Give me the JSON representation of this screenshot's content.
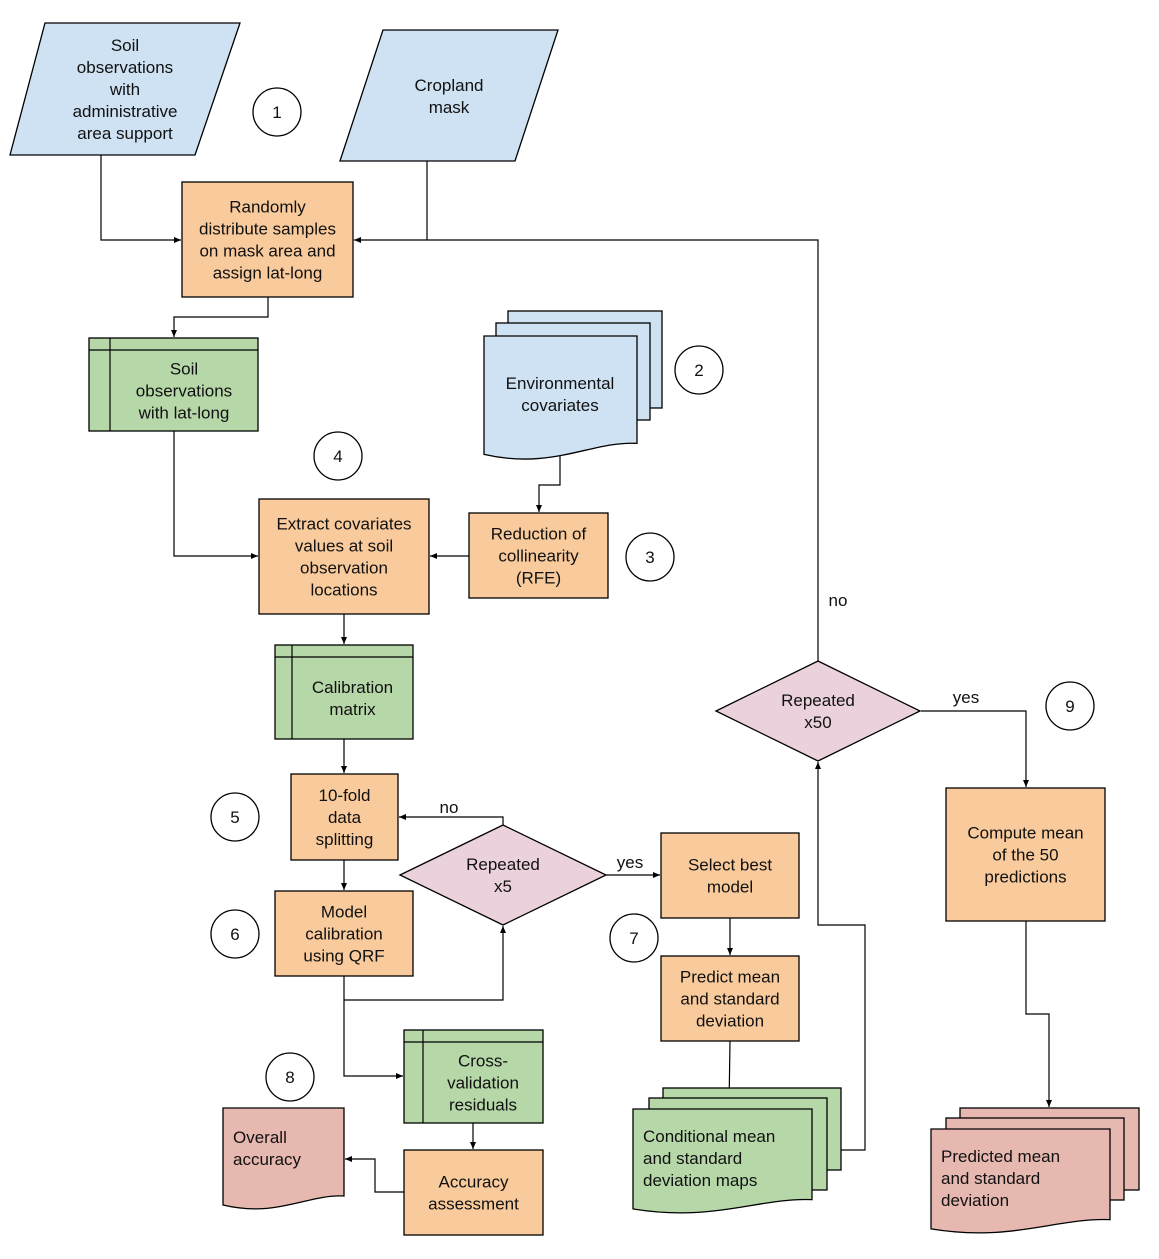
{
  "colors": {
    "input": "#cfe2f3",
    "process": "#f9cb9c",
    "data": "#b6d7a8",
    "decision": "#ead1dc",
    "output": "#e6b8af"
  },
  "nodes": {
    "soil_admin": {
      "lines": [
        "Soil",
        "observations",
        "with",
        "administrative",
        "area support"
      ]
    },
    "cropland": {
      "lines": [
        "Cropland",
        "mask"
      ]
    },
    "randomly": {
      "lines": [
        "Randomly",
        "distribute samples",
        "on mask area and",
        "assign lat-long"
      ]
    },
    "soil_latlong": {
      "lines": [
        "Soil",
        "observations",
        "with lat-long"
      ]
    },
    "env_cov": {
      "lines": [
        "Environmental",
        "covariates"
      ]
    },
    "extract": {
      "lines": [
        "Extract covariates",
        "values at soil",
        "observation",
        "locations"
      ]
    },
    "reduction": {
      "lines": [
        "Reduction of",
        "collinearity",
        "(RFE)"
      ]
    },
    "calib_matrix": {
      "lines": [
        "Calibration",
        "matrix"
      ]
    },
    "tenfold": {
      "lines": [
        "10-fold",
        "data",
        "splitting"
      ]
    },
    "rep5": {
      "lines": [
        "Repeated",
        "x5"
      ]
    },
    "model_cal": {
      "lines": [
        "Model",
        "calibration",
        "using QRF"
      ]
    },
    "select_best": {
      "lines": [
        "Select best",
        "model"
      ]
    },
    "predict": {
      "lines": [
        "Predict mean",
        "and standard",
        "deviation"
      ]
    },
    "crossval": {
      "lines": [
        "Cross-",
        "validation",
        "residuals"
      ]
    },
    "overall": {
      "lines": [
        "Overall",
        "accuracy"
      ]
    },
    "accuracy": {
      "lines": [
        "Accuracy",
        "assessment"
      ]
    },
    "cond_maps": {
      "lines": [
        "Conditional mean",
        "and standard",
        "deviation maps"
      ]
    },
    "rep50": {
      "lines": [
        "Repeated",
        "x50"
      ]
    },
    "compute": {
      "lines": [
        "Compute mean",
        "of the 50",
        "predictions"
      ]
    },
    "predicted": {
      "lines": [
        "Predicted mean",
        "and standard",
        "deviation"
      ]
    }
  },
  "step_numbers": [
    "1",
    "2",
    "3",
    "4",
    "5",
    "6",
    "7",
    "8",
    "9"
  ],
  "edge_labels": {
    "rep5_no": "no",
    "rep5_yes": "yes",
    "rep50_no": "no",
    "rep50_yes": "yes"
  }
}
